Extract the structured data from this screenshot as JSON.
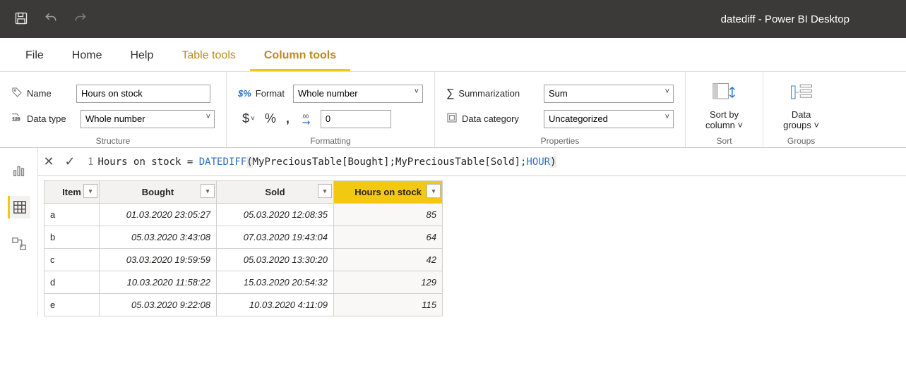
{
  "titlebar": {
    "title": "datediff - Power BI Desktop"
  },
  "menubar": {
    "file": "File",
    "home": "Home",
    "help": "Help",
    "table_tools": "Table tools",
    "column_tools": "Column tools"
  },
  "ribbon": {
    "structure": {
      "group_label": "Structure",
      "name_label": "Name",
      "name_value": "Hours on stock",
      "datatype_label": "Data type",
      "datatype_value": "Whole number"
    },
    "formatting": {
      "group_label": "Formatting",
      "format_label": "Format",
      "format_value": "Whole number",
      "decimal_value": "0"
    },
    "properties": {
      "group_label": "Properties",
      "summarization_label": "Summarization",
      "summarization_value": "Sum",
      "datacategory_label": "Data category",
      "datacategory_value": "Uncategorized"
    },
    "sort": {
      "group_label": "Sort",
      "sort_by_column": "Sort by\ncolumn ˅"
    },
    "groups": {
      "group_label": "Groups",
      "data_groups": "Data\ngroups ˅"
    }
  },
  "formula": {
    "line": "1",
    "col": "Hours on stock",
    "fn": "DATEDIFF",
    "arg1": "MyPreciousTable[Bought]",
    "arg2": "MyPreciousTable[Sold]",
    "arg3": "HOUR"
  },
  "table": {
    "headers": {
      "item": "Item",
      "bought": "Bought",
      "sold": "Sold",
      "hours": "Hours on stock"
    },
    "rows": [
      {
        "item": "a",
        "bought": "01.03.2020 23:05:27",
        "sold": "05.03.2020 12:08:35",
        "hours": "85"
      },
      {
        "item": "b",
        "bought": "05.03.2020 3:43:08",
        "sold": "07.03.2020 19:43:04",
        "hours": "64"
      },
      {
        "item": "c",
        "bought": "03.03.2020 19:59:59",
        "sold": "05.03.2020 13:30:20",
        "hours": "42"
      },
      {
        "item": "d",
        "bought": "10.03.2020 11:58:22",
        "sold": "15.03.2020 20:54:32",
        "hours": "129"
      },
      {
        "item": "e",
        "bought": "05.03.2020 9:22:08",
        "sold": "10.03.2020 4:11:09",
        "hours": "115"
      }
    ]
  }
}
